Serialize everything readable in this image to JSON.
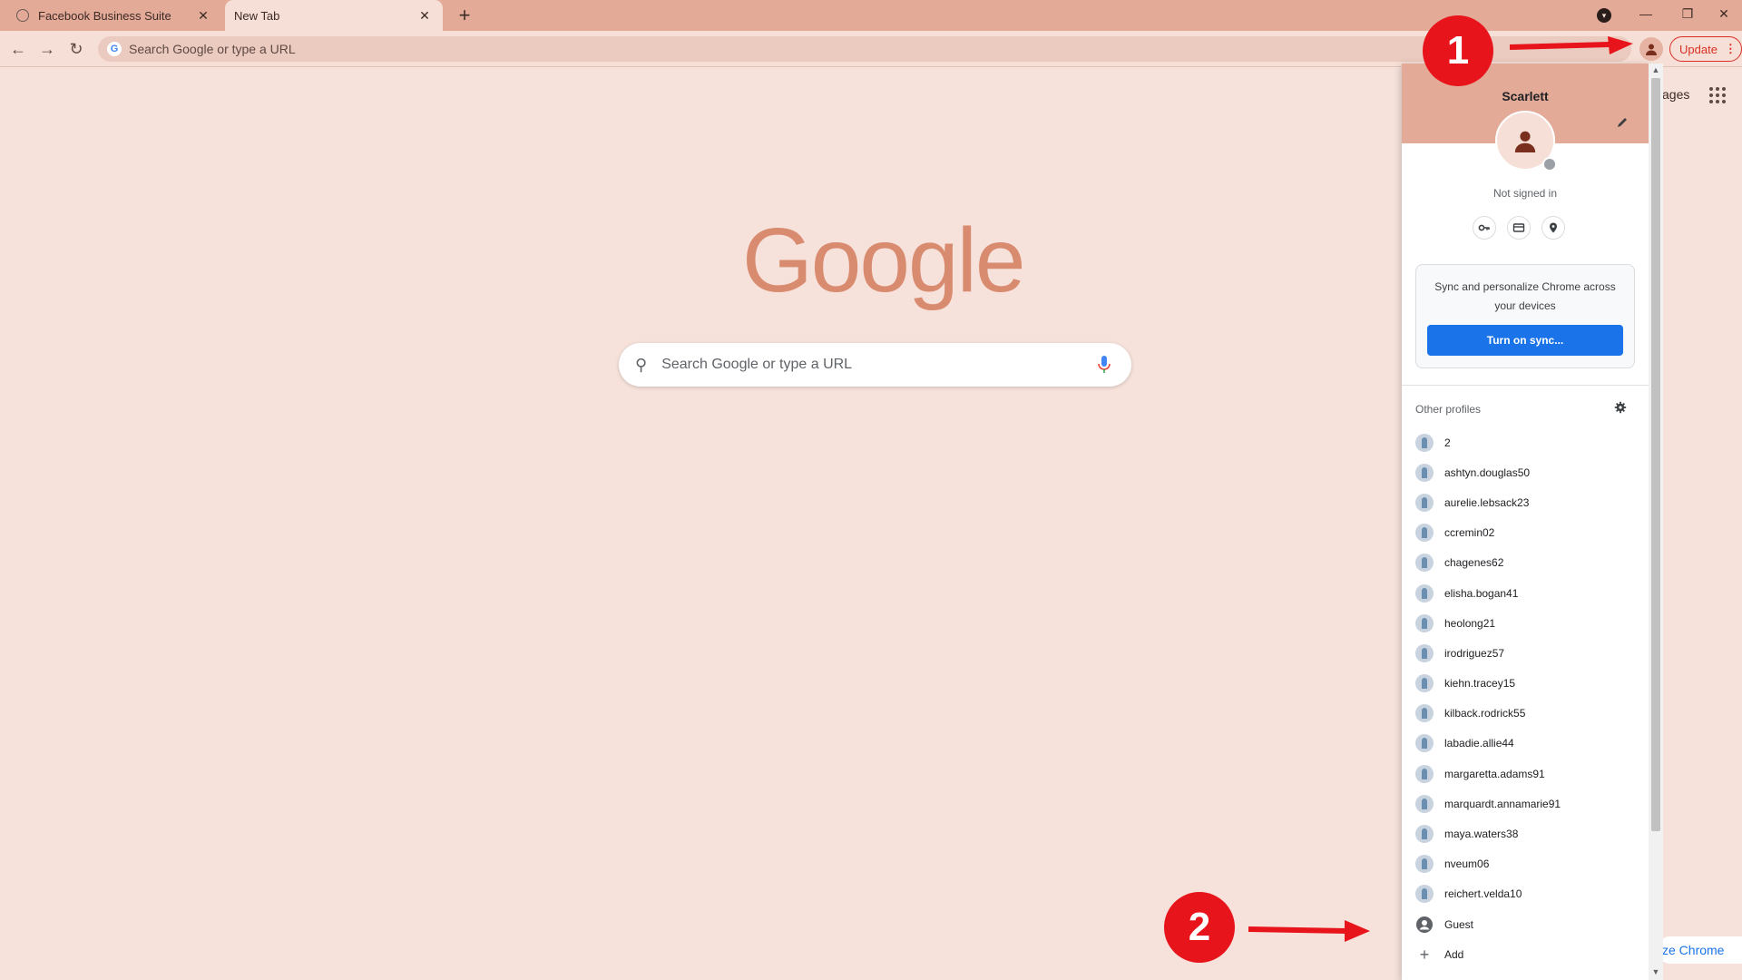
{
  "tabs": [
    {
      "label": "Facebook Business Suite"
    },
    {
      "label": "New Tab"
    }
  ],
  "tab_close_glyph": "✕",
  "new_tab_glyph": "+",
  "toolbar": {
    "omnibox_placeholder": "Search Google or type a URL",
    "update_label": "Update"
  },
  "page": {
    "logo_text": "Google",
    "search_placeholder": "Search Google or type a URL",
    "apps_partial_label": "ages",
    "customize_partial_label": "ze Chrome"
  },
  "profile_menu": {
    "name": "Scarlett",
    "status": "Not signed in",
    "sync_text": "Sync and personalize Chrome across your devices",
    "sync_button": "Turn on sync...",
    "other_profiles_label": "Other profiles",
    "profiles": [
      "2",
      "ashtyn.douglas50",
      "aurelie.lebsack23",
      "ccremin02",
      "chagenes62",
      "elisha.bogan41",
      "heolong21",
      "irodriguez57",
      "kiehn.tracey15",
      "kilback.rodrick55",
      "labadie.allie44",
      "margaretta.adams91",
      "marquardt.annamarie91",
      "maya.waters38",
      "nveum06",
      "reichert.velda10"
    ],
    "guest_label": "Guest",
    "add_label": "Add"
  },
  "annotations": {
    "callout_1": "1",
    "callout_2": "2",
    "color": "#e8141c"
  },
  "colors": {
    "tabstrip": "#e3aa98",
    "toolbar": "#f6dfd6",
    "page_bg": "#f6e2db",
    "sync_button": "#1a73e8",
    "update_accent": "#d93025"
  },
  "icons": {
    "back": "back-arrow-icon",
    "forward": "forward-arrow-icon",
    "reload": "reload-icon",
    "profile": "person-icon",
    "edit": "pencil-icon",
    "password": "key-icon",
    "payment": "card-icon",
    "address": "location-pin-icon",
    "settings": "gear-icon",
    "search": "magnifier-icon",
    "voice": "microphone-icon",
    "apps": "apps-grid-icon"
  }
}
